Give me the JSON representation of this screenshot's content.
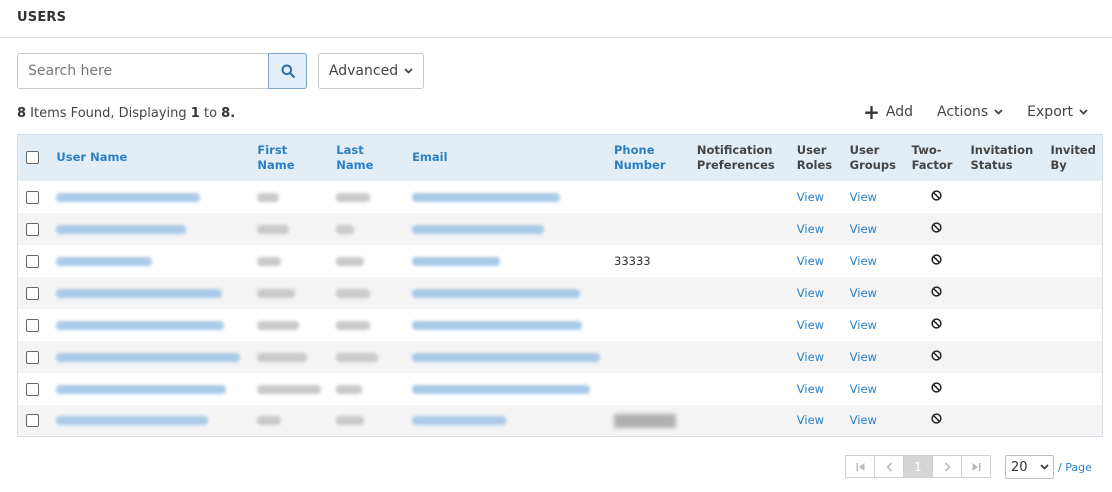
{
  "header": {
    "title": "USERS"
  },
  "search": {
    "placeholder": "Search here",
    "advanced_label": "Advanced"
  },
  "summary": {
    "count": "8",
    "text1": " Items Found, Displaying ",
    "from": "1",
    "text2": " to ",
    "to": "8",
    "text3": "."
  },
  "toolbar": {
    "add": "Add",
    "actions": "Actions",
    "export": "Export"
  },
  "table": {
    "headers": {
      "user_name": "User Name",
      "first_name": "First Name",
      "last_name": "Last Name",
      "email": "Email",
      "phone_1": "Phone",
      "phone_2": "Number",
      "notif_1": "Notification",
      "notif_2": "Preferences",
      "roles_1": "User",
      "roles_2": "Roles",
      "groups_1": "User",
      "groups_2": "Groups",
      "twofactor_1": "Two-",
      "twofactor_2": "Factor",
      "invitation_1": "Invitation",
      "invitation_2": "Status",
      "invited_1": "Invited",
      "invited_2": "By"
    },
    "rows": [
      {
        "phone": "",
        "roles": "View",
        "groups": "View"
      },
      {
        "phone": "",
        "roles": "View",
        "groups": "View"
      },
      {
        "phone": "33333",
        "roles": "View",
        "groups": "View"
      },
      {
        "phone": "",
        "roles": "View",
        "groups": "View"
      },
      {
        "phone": "",
        "roles": "View",
        "groups": "View"
      },
      {
        "phone": "",
        "roles": "View",
        "groups": "View"
      },
      {
        "phone": "",
        "roles": "View",
        "groups": "View"
      },
      {
        "phone": "",
        "roles": "View",
        "groups": "View"
      }
    ]
  },
  "pagination": {
    "current_page": "1",
    "per_page": "20",
    "per_page_label": "/ Page"
  },
  "colors": {
    "link": "#2b7fc3",
    "header_bg": "#e3edf5",
    "row_alt": "#f4f4f4"
  }
}
